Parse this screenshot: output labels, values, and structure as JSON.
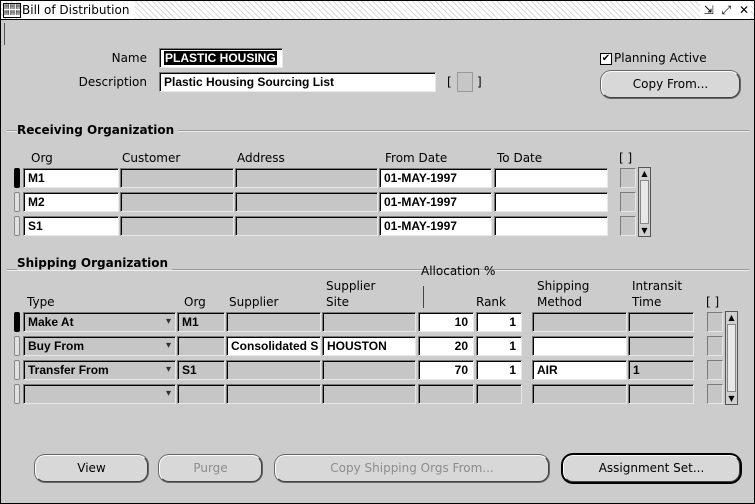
{
  "window": {
    "title": "Bill of Distribution",
    "controls": "⇲ ⤢ ✕"
  },
  "header": {
    "name_label": "Name",
    "name_value": "PLASTIC HOUSING",
    "description_label": "Description",
    "description_value": "Plastic Housing Sourcing List",
    "planning_active_label": "Planning Active",
    "planning_active_checked": "✔",
    "copy_from_label": "Copy From...",
    "desc_flex_left": "[",
    "desc_flex_right": "]"
  },
  "receiving": {
    "title": "Receiving Organization",
    "columns": {
      "org": "Org",
      "customer": "Customer",
      "address": "Address",
      "from_date": "From Date",
      "to_date": "To Date",
      "flex": "[ ]"
    },
    "rows": [
      {
        "org": "M1",
        "customer": "",
        "address": "",
        "from_date": "01-MAY-1997",
        "to_date": ""
      },
      {
        "org": "M2",
        "customer": "",
        "address": "",
        "from_date": "01-MAY-1997",
        "to_date": ""
      },
      {
        "org": "S1",
        "customer": "",
        "address": "",
        "from_date": "01-MAY-1997",
        "to_date": ""
      }
    ]
  },
  "shipping": {
    "title": "Shipping Organization",
    "columns": {
      "type": "Type",
      "org": "Org",
      "supplier": "Supplier",
      "supplier_site_1": "Supplier",
      "supplier_site_2": "Site",
      "allocation": "Allocation %",
      "rank": "Rank",
      "ship_method_1": "Shipping",
      "ship_method_2": "Method",
      "intransit_1": "Intransit",
      "intransit_2": "Time",
      "flex": "[ ]"
    },
    "rows": [
      {
        "type": "Make At",
        "org": "M1",
        "supplier": "",
        "site": "",
        "allocation": "10",
        "rank": "1",
        "method": "",
        "time": ""
      },
      {
        "type": "Buy From",
        "org": "",
        "supplier": "Consolidated S",
        "site": "HOUSTON",
        "allocation": "20",
        "rank": "1",
        "method": "",
        "time": ""
      },
      {
        "type": "Transfer From",
        "org": "S1",
        "supplier": "",
        "site": "",
        "allocation": "70",
        "rank": "1",
        "method": "AIR",
        "time": "1"
      },
      {
        "type": "",
        "org": "",
        "supplier": "",
        "site": "",
        "allocation": "",
        "rank": "",
        "method": "",
        "time": ""
      }
    ]
  },
  "buttons": {
    "view": "View",
    "purge": "Purge",
    "copy_shipping": "Copy Shipping Orgs From...",
    "assignment_set": "Assignment Set..."
  }
}
